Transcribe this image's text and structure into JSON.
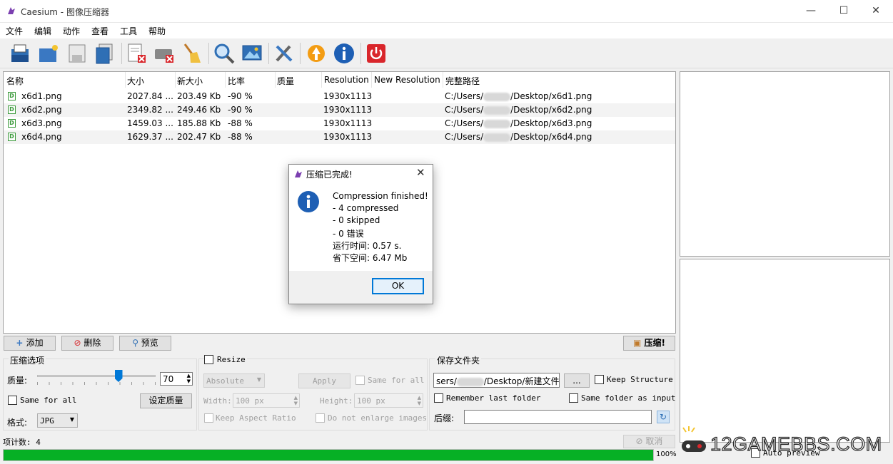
{
  "window": {
    "title": "Caesium - 图像压缩器"
  },
  "menu": [
    "文件",
    "编辑",
    "动作",
    "查看",
    "工具",
    "帮助"
  ],
  "table": {
    "columns": [
      "名称",
      "大小",
      "新大小",
      "比率",
      "质量",
      "Resolution",
      "New Resolution",
      "完整路径"
    ],
    "rows": [
      {
        "name": "x6d1.png",
        "size": "2027.84 ...",
        "new_size": "203.49 Kb",
        "ratio": "-90 %",
        "quality": "",
        "resolution": "1930x1113",
        "new_resolution": "",
        "path_prefix": "C:/Users/",
        "path_suffix": "/Desktop/x6d1.png"
      },
      {
        "name": "x6d2.png",
        "size": "2349.82 ...",
        "new_size": "249.46 Kb",
        "ratio": "-90 %",
        "quality": "",
        "resolution": "1930x1113",
        "new_resolution": "",
        "path_prefix": "C:/Users/",
        "path_suffix": "/Desktop/x6d2.png"
      },
      {
        "name": "x6d3.png",
        "size": "1459.03 ...",
        "new_size": "185.88 Kb",
        "ratio": "-88 %",
        "quality": "",
        "resolution": "1930x1113",
        "new_resolution": "",
        "path_prefix": "C:/Users/",
        "path_suffix": "/Desktop/x6d3.png"
      },
      {
        "name": "x6d4.png",
        "size": "1629.37 ...",
        "new_size": "202.47 Kb",
        "ratio": "-88 %",
        "quality": "",
        "resolution": "1930x1113",
        "new_resolution": "",
        "path_prefix": "C:/Users/",
        "path_suffix": "/Desktop/x6d4.png"
      }
    ]
  },
  "actions": {
    "add": "添加",
    "delete": "删除",
    "preview": "预览",
    "compress": "压缩!"
  },
  "compression": {
    "group_title": "压缩选项",
    "quality_label": "质量:",
    "quality_value": "70",
    "slider_level": 70,
    "same_for_all": "Same for all",
    "set_quality": "设定质量",
    "format_label": "格式:",
    "format_value": "JPG"
  },
  "resize": {
    "title": "Resize",
    "mode": "Absolute",
    "apply": "Apply",
    "same_for_all": "Same for all",
    "width_label": "Width:",
    "width_value": "100 px",
    "height_label": "Height:",
    "height_value": "100 px",
    "keep_aspect": "Keep Aspect Ratio",
    "no_enlarge": "Do not enlarge images"
  },
  "output": {
    "group_title": "保存文件夹",
    "folder_prefix": "sers/",
    "folder_suffix": "/Desktop/新建文件夹",
    "browse": "...",
    "keep_structure": "Keep Structure",
    "remember_last": "Remember last folder",
    "same_folder": "Same folder as input",
    "suffix_label": "后缀:",
    "suffix_value": ""
  },
  "status": {
    "item_count": "项计数: 4",
    "cancel": "取消",
    "progress_text": "100%",
    "progress_value": 100,
    "auto_preview": "Auto preview"
  },
  "dialog": {
    "title": "压缩已完成!",
    "lines": [
      "Compression finished!",
      "- 4 compressed",
      "- 0 skipped",
      "- 0 错误",
      "运行时间: 0.57 s.",
      "省下空间: 6.47 Mb"
    ],
    "ok": "OK"
  },
  "watermark": "12GAMEBBS.COM",
  "colors": {
    "progress": "#06b025",
    "info_icon": "#1e5fb4",
    "accent": "#0078d7"
  }
}
